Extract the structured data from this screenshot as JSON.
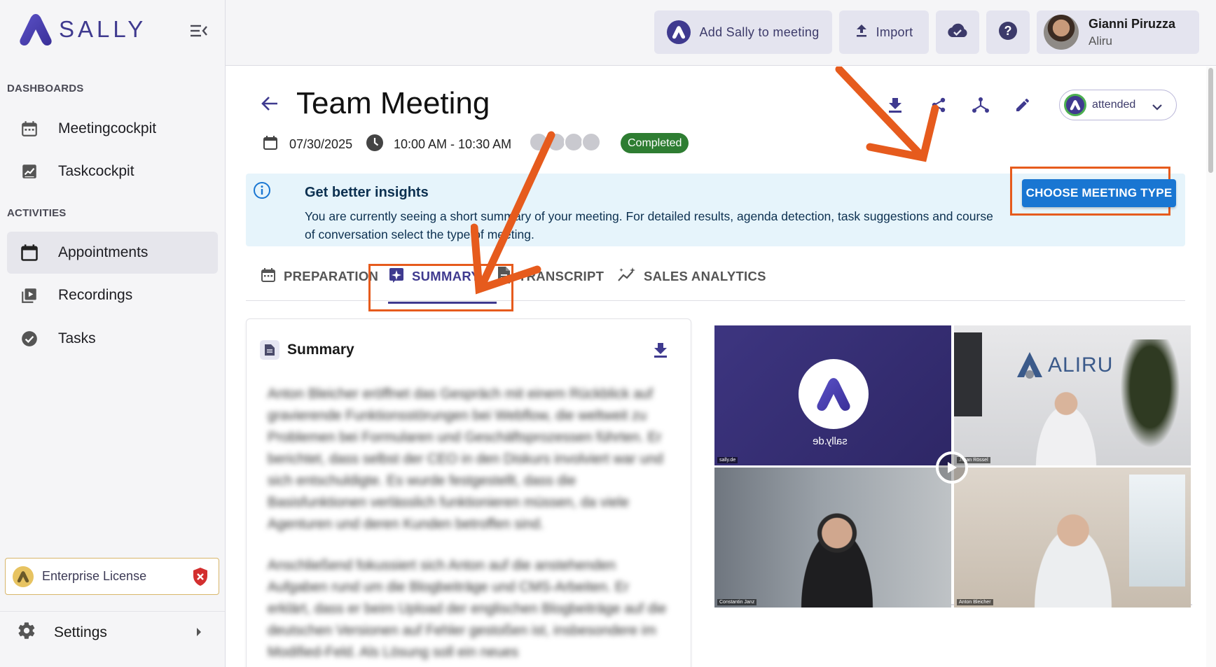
{
  "brand": {
    "name": "SALLY"
  },
  "sidebar": {
    "sections": [
      {
        "label": "DASHBOARDS"
      },
      {
        "label": "ACTIVITIES"
      }
    ],
    "items": [
      {
        "label": "Meetingcockpit",
        "icon": "calendar-icon"
      },
      {
        "label": "Taskcockpit",
        "icon": "chart-icon"
      },
      {
        "label": "Appointments",
        "icon": "calendar-blank-icon",
        "active": true
      },
      {
        "label": "Recordings",
        "icon": "video-library-icon"
      },
      {
        "label": "Tasks",
        "icon": "check-circle-icon"
      }
    ],
    "license": "Enterprise License",
    "settings": "Settings"
  },
  "header": {
    "add_sally": "Add Sally to meeting",
    "import": "Import",
    "user": {
      "name": "Gianni Piruzza",
      "org": "Aliru"
    }
  },
  "meeting": {
    "title": "Team Meeting",
    "date": "07/30/2025",
    "time": "10:00 AM - 10:30 AM",
    "status": "Completed",
    "attendance": "attended"
  },
  "banner": {
    "heading": "Get better insights",
    "body": "You are currently seeing a short summary of your meeting. For detailed results, agenda detection, task suggestions and course of conversation select the type of meeting.",
    "button": "CHOOSE MEETING TYPE"
  },
  "tabs": [
    {
      "label": "PREPARATION"
    },
    {
      "label": "SUMMARY",
      "active": true
    },
    {
      "label": "TRANSCRIPT"
    },
    {
      "label": "SALES ANALYTICS"
    }
  ],
  "summary": {
    "heading": "Summary",
    "paragraphs": [
      "Anton Bleicher eröffnet das Gespräch mit einem Rückblick auf gravierende Funktionsstörungen bei Webflow, die weltweit zu Problemen bei Formularen und Geschäftsprozessen führten. Er berichtet, dass selbst der CEO in den Diskurs involviert war und sich entschuldigte. Es wurde festgestellt, dass die Basisfunktionen verlässlich funktionieren müssen, da viele Agenturen und deren Kunden betroffen sind.",
      "Anschließend fokussiert sich Anton auf die anstehenden Aufgaben rund um die Blogbeiträge und CMS-Arbeiten. Er erklärt, dass er beim Upload der englischen Blogbeiträge auf die deutschen Versionen auf Fehler gestoßen ist, insbesondere im Modified-Feld. Als Lösung soll ein neues"
    ]
  },
  "video": {
    "tiles": [
      {
        "logo_text": "sally.de",
        "caption": "sally.de"
      },
      {
        "logo_text": "ALIRU",
        "caption": "Julian Rössel"
      },
      {
        "caption": "Constantin Janz"
      },
      {
        "caption": "Anton Bleicher"
      }
    ]
  },
  "colors": {
    "accent": "#3f3a8f",
    "callout": "#e65b1d",
    "success": "#2e7d32",
    "primary_button": "#1976d2",
    "info_bg": "#e6f4fb"
  }
}
